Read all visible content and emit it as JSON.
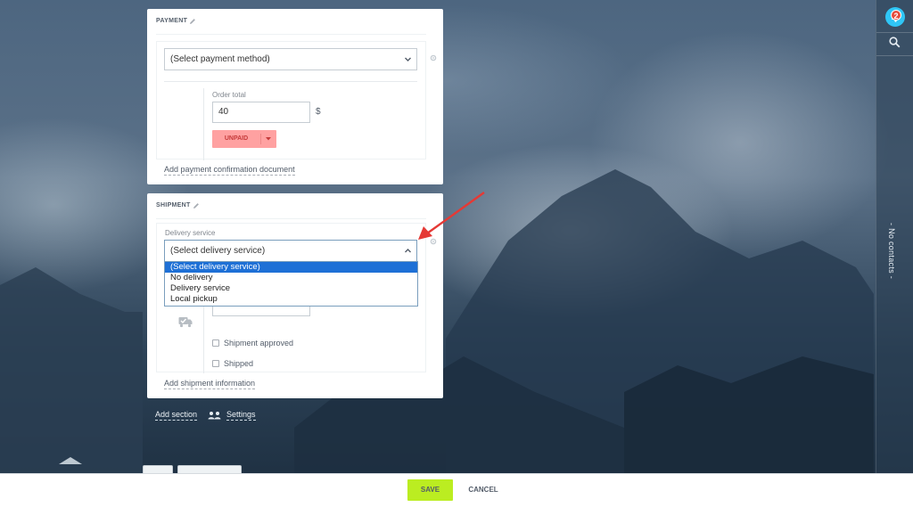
{
  "sidebar_right": {
    "notifications_count": "2",
    "no_contacts_label": "- No contacts -"
  },
  "payment": {
    "title": "PAYMENT",
    "method_placeholder": "(Select payment method)",
    "order_total_label": "Order total",
    "order_total_value": "40",
    "currency": "$",
    "status_button": "UNPAID",
    "add_document_link": "Add payment confirmation document"
  },
  "shipment": {
    "title": "SHIPMENT",
    "delivery_service_label": "Delivery service",
    "delivery_selected": "(Select delivery service)",
    "options": [
      "(Select delivery service)",
      "No delivery",
      "Delivery service",
      "Local pickup"
    ],
    "checkbox_approved": "Shipment approved",
    "checkbox_shipped": "Shipped",
    "add_info_link": "Add shipment information"
  },
  "page_actions": {
    "add_section": "Add section",
    "settings": "Settings"
  },
  "bottom_bar": {
    "save": "SAVE",
    "cancel": "CANCEL"
  },
  "colors": {
    "accent_green": "#bbed21",
    "unpaid_red": "#ffa1a1",
    "selection_blue": "#1e70d6",
    "notification_blue": "#2fc6f6",
    "arrow_red": "#e53935"
  }
}
